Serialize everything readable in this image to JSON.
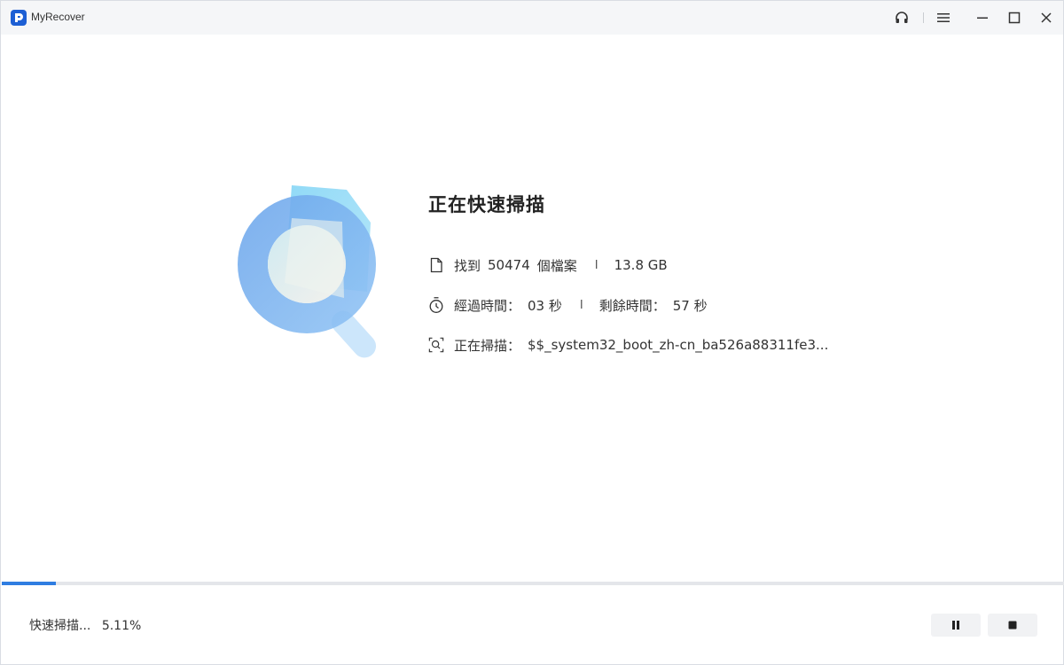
{
  "titlebar": {
    "app_title": "MyRecover",
    "icons": [
      "app-logo",
      "headset-icon",
      "menu-icon",
      "minimize-icon",
      "maximize-icon",
      "close-icon"
    ]
  },
  "scan": {
    "title": "正在快速掃描",
    "found_label": "找到",
    "found_count": "50474",
    "found_unit": "個檔案",
    "separator": "I",
    "found_size": "13.8 GB",
    "elapsed_label": "經過時間：",
    "elapsed_value": "03 秒",
    "remaining_label": "剩餘時間：",
    "remaining_value": "57 秒",
    "scanning_label": "正在掃描：",
    "scanning_file": "$$_system32_boot_zh-cn_ba526a88311fe3..."
  },
  "footer": {
    "status_label": "快速掃描...",
    "percent_text": "5.11%",
    "progress_fraction": 0.0511,
    "icons": [
      "pause-icon",
      "stop-icon"
    ]
  },
  "colors": {
    "accent": "#2f7de1",
    "logo": "#1d5fd4",
    "titlebar_bg": "#f5f6f8",
    "button_bg": "#f1f2f4"
  }
}
